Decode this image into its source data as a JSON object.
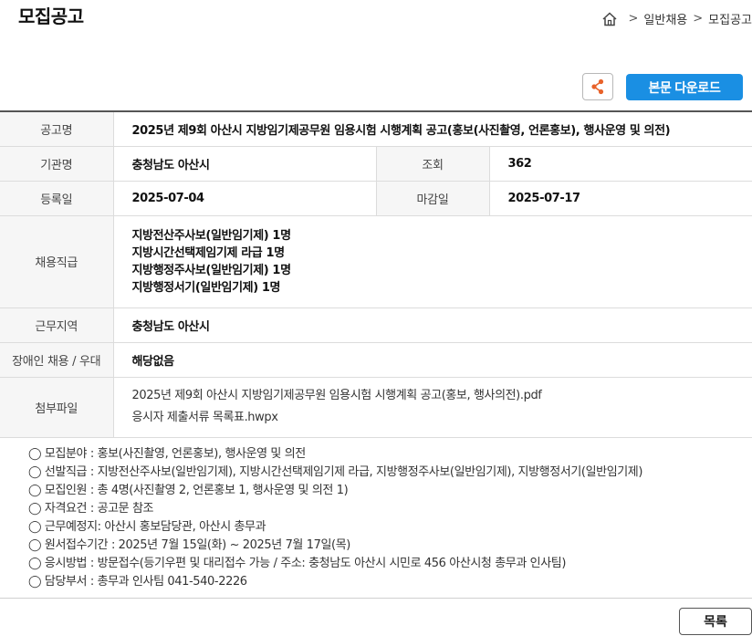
{
  "page": {
    "title": "모집공고"
  },
  "breadcrumb": {
    "items": [
      "일반채용",
      "모집공고"
    ],
    "separator": ">"
  },
  "actions": {
    "download_label": "본문 다운로드",
    "download_color": "#1a8fe3",
    "share_icon_color": "#e8622a",
    "list_label": "목록"
  },
  "info": {
    "title_label": "공고명",
    "title_value": "2025년 제9회 아산시 지방임기제공무원 임용시험 시행계획 공고(홍보(사진촬영, 언론홍보), 행사운영 및 의전)",
    "agency_label": "기관명",
    "agency_value": "충청남도 아산시",
    "views_label": "조회",
    "views_value": "362",
    "reg_label": "등록일",
    "reg_value": "2025-07-04",
    "deadline_label": "마감일",
    "deadline_value": "2025-07-17",
    "positions_label": "채용직급",
    "positions": [
      "지방전산주사보(일반임기제) 1명",
      "지방시간선택제임기제 라급 1명",
      "지방행정주사보(일반임기제) 1명",
      "지방행정서기(일반임기제) 1명"
    ],
    "location_label": "근무지역",
    "location_value": "충청남도 아산시",
    "disabled_label": "장애인 채용 / 우대",
    "disabled_value": "해당없음",
    "attach_label": "첨부파일",
    "attachments": [
      "2025년 제9회 아산시 지방임기제공무원 임용시험 시행계획 공고(홍보, 행사의전).pdf",
      "응시자 제출서류 목록표.hwpx"
    ]
  },
  "summary": [
    "◯ 모집분야 : 홍보(사진촬영, 언론홍보), 행사운영 및 의전",
    "◯ 선발직급 : 지방전산주사보(일반임기제), 지방시간선택제임기제 라급, 지방행정주사보(일반임기제), 지방행정서기(일반임기제)",
    "◯ 모집인원 : 총 4명(사진촬영 2, 언론홍보 1, 행사운영 및 의전 1)",
    "◯ 자격요건 : 공고문 참조",
    "◯ 근무예정지: 아산시 홍보담당관, 아산시 총무과",
    "◯ 원서접수기간 : 2025년 7월 15일(화) ~ 2025년 7월 17일(목)",
    "◯ 응시방법 : 방문접수(등기우편 및 대리접수 가능 / 주소: 충청남도 아산시 시민로 456 아산시청 총무과 인사팀)",
    "◯ 담당부서 : 총무과 인사팀 041-540-2226"
  ]
}
